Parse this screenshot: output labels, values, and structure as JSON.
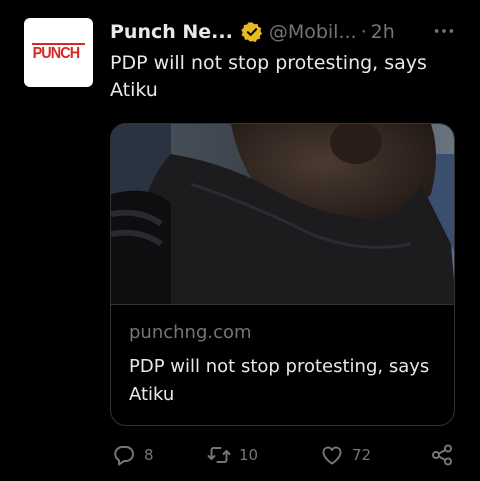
{
  "avatar": {
    "logo_text": "PUNCH",
    "brand_color": "#d62828"
  },
  "author": {
    "name": "Punch Ne...",
    "handle": "@Mobil...",
    "separator": "·",
    "time": "2h",
    "verified_color": "#e8b923"
  },
  "tweet": {
    "text": "PDP will not stop protesting, says Atiku"
  },
  "card": {
    "domain": "punchng.com",
    "title": "PDP will not stop protesting, says Atiku",
    "image": "photo-man-black-shirt"
  },
  "actions": {
    "reply": {
      "icon": "reply-icon",
      "count": "8"
    },
    "retweet": {
      "icon": "retweet-icon",
      "count": "10"
    },
    "like": {
      "icon": "heart-icon",
      "count": "72"
    },
    "share": {
      "icon": "share-icon"
    }
  },
  "colors": {
    "background": "#000000",
    "text": "#e7e9ea",
    "muted": "#71767b",
    "border": "#2f3336"
  }
}
